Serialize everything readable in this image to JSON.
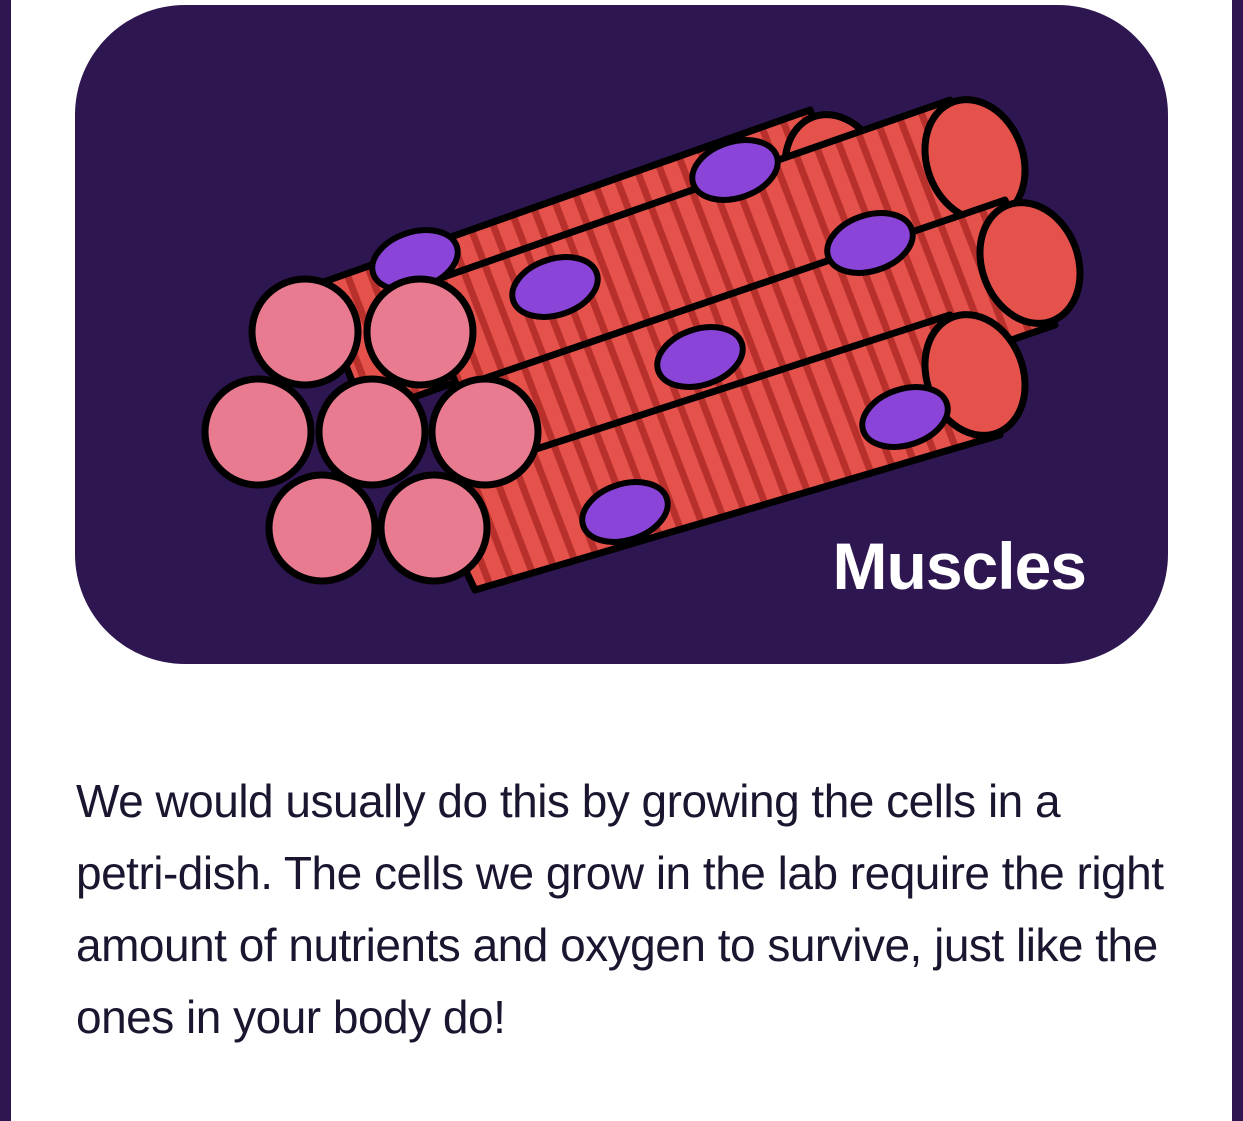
{
  "card": {
    "label": "Muscles",
    "background": "#2e1650",
    "illustration_icon": "muscle-fibers-icon"
  },
  "body_text": "We would usually do this by growing the cells in a petri-dish. The cells we grow in the lab require the right amount of nutrients and oxygen to survive, just like the ones in your body do!",
  "colors": {
    "fiber": "#e5514b",
    "fiber_end": "#e87b8f",
    "nucleus": "#8a45d8",
    "outline": "#000000",
    "text": "#1b1530",
    "page_border": "#2e1650"
  }
}
